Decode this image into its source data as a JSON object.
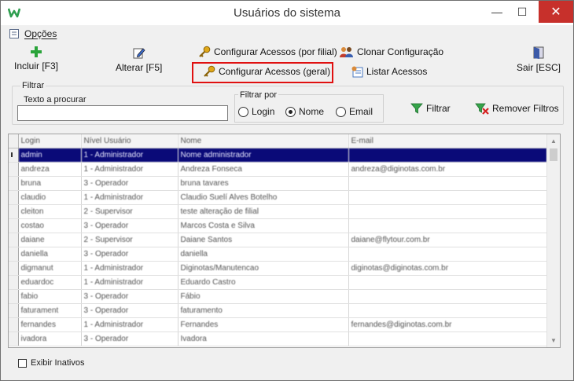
{
  "window": {
    "title": "Usuários do sistema",
    "minimize_glyph": "—",
    "maximize_glyph": "☐",
    "close_glyph": "✕"
  },
  "menu": {
    "options_label": "Opções"
  },
  "toolbar": {
    "add_label": "Incluir [F3]",
    "edit_label": "Alterar [F5]",
    "config_branch_label": "Configurar Acessos (por filial)",
    "config_general_label": "Configurar Acessos (geral)",
    "clone_label": "Clonar Configuração",
    "list_label": "Listar Acessos",
    "exit_label": "Sair [ESC]"
  },
  "filter": {
    "group_label": "Filtrar",
    "search_label": "Texto a procurar",
    "search_value": "",
    "filter_by_label": "Filtrar por",
    "options": [
      "Login",
      "Nome",
      "Email"
    ],
    "selected": "Nome",
    "apply_label": "Filtrar",
    "clear_label": "Remover Filtros"
  },
  "grid": {
    "columns": [
      "Login",
      "Nível Usuário",
      "Nome",
      "E-mail"
    ],
    "rows": [
      [
        "admin",
        "1 - Administrador",
        "Nome administrador",
        ""
      ],
      [
        "andreza",
        "1 - Administrador",
        "Andreza Fonseca",
        "andreza@diginotas.com.br"
      ],
      [
        "bruna",
        "3 - Operador",
        "bruna tavares",
        ""
      ],
      [
        "claudio",
        "1 - Administrador",
        "Claudio Suelí Alves Botelho",
        ""
      ],
      [
        "cleiton",
        "2 - Supervisor",
        "teste alteração de filial",
        ""
      ],
      [
        "costao",
        "3 - Operador",
        "Marcos Costa e Silva",
        ""
      ],
      [
        "daiane",
        "2 - Supervisor",
        "Daiane Santos",
        "daiane@flytour.com.br"
      ],
      [
        "daniella",
        "3 - Operador",
        "daniella",
        ""
      ],
      [
        "digmanut",
        "1 - Administrador",
        "Diginotas/Manutencao",
        "diginotas@diginotas.com.br"
      ],
      [
        "eduardoc",
        "1 - Administrador",
        "Eduardo Castro",
        ""
      ],
      [
        "fabio",
        "3 - Operador",
        "Fábio",
        ""
      ],
      [
        "faturament",
        "3 - Operador",
        "faturamento",
        ""
      ],
      [
        "fernandes",
        "1 - Administrador",
        "Fernandes",
        "fernandes@diginotas.com.br"
      ],
      [
        "ivadora",
        "3 - Operador",
        "Ivadora",
        ""
      ]
    ],
    "selected_index": 0
  },
  "footer": {
    "show_inactive_label": "Exibir Inativos"
  },
  "colors": {
    "selection": "#0a0a78",
    "highlight": "#e01010",
    "close": "#c7302b"
  }
}
